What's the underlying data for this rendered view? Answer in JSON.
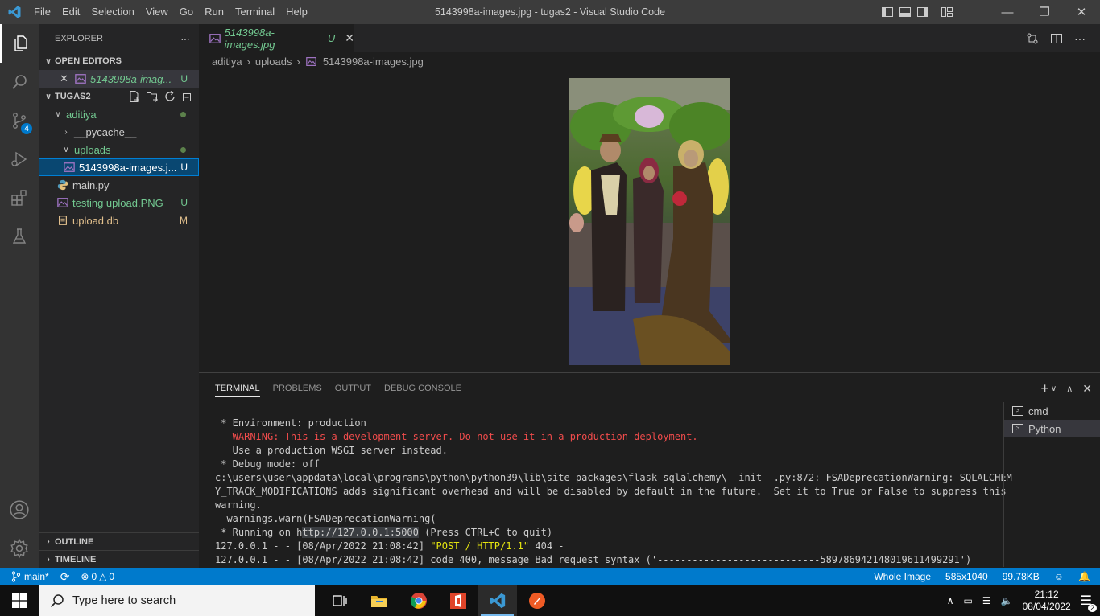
{
  "titlebar": {
    "menu": [
      "File",
      "Edit",
      "Selection",
      "View",
      "Go",
      "Run",
      "Terminal",
      "Help"
    ],
    "title": "5143998a-images.jpg - tugas2 - Visual Studio Code"
  },
  "activitybar": {
    "source_control_badge": "4"
  },
  "sidebar": {
    "title": "EXPLORER",
    "more": "···",
    "open_editors_label": "OPEN EDITORS",
    "open_editor": {
      "name": "5143998a-imag...",
      "status": "U"
    },
    "folder_label": "TUGAS2",
    "tree": {
      "aditiya": "aditiya",
      "pycache": "__pycache__",
      "uploads": "uploads",
      "image_file": "5143998a-images.j...",
      "image_status": "U",
      "main_py": "main.py",
      "testing": "testing upload.PNG",
      "testing_status": "U",
      "upload_db": "upload.db",
      "upload_db_status": "M"
    },
    "outline_label": "OUTLINE",
    "timeline_label": "TIMELINE"
  },
  "editor": {
    "tab_name": "5143998a-images.jpg",
    "tab_status": "U",
    "breadcrumb": [
      "aditiya",
      "uploads",
      "5143998a-images.jpg"
    ]
  },
  "panel": {
    "tabs": [
      "TERMINAL",
      "PROBLEMS",
      "OUTPUT",
      "DEBUG CONSOLE"
    ],
    "terminals": [
      "cmd",
      "Python"
    ],
    "lines": {
      "l1": " * Environment: production",
      "l2": "   WARNING: This is a development server. Do not use it in a production deployment.",
      "l3": "   Use a production WSGI server instead.",
      "l4": " * Debug mode: off",
      "l5": "c:\\users\\user\\appdata\\local\\programs\\python\\python39\\lib\\site-packages\\flask_sqlalchemy\\__init__.py:872: FSADeprecationWarning: SQLALCHEM",
      "l6": "Y_TRACK_MODIFICATIONS adds significant overhead and will be disabled by default in the future.  Set it to True or False to suppress this",
      "l7": "warning.",
      "l8": "  warnings.warn(FSADeprecationWarning(",
      "l9a": " * Running on h",
      "l9b": "ttp://127.0.0.1:5000",
      "l9c": " (Press CTRL+C to quit)",
      "l10a": "127.0.0.1 - - [08/Apr/2022 21:08:42] ",
      "l10b": "\"POST / HTTP/1.1\"",
      "l10c": " 404 -",
      "l11": "127.0.0.1 - - [08/Apr/2022 21:08:42] code 400, message Bad request syntax ('----------------------------589786942148019611499291')"
    }
  },
  "statusbar": {
    "branch": "main*",
    "errors": "0",
    "warnings": "0",
    "zoom": "Whole Image",
    "dimensions": "585x1040",
    "size": "99.78KB"
  },
  "taskbar": {
    "search_placeholder": "Type here to search",
    "time": "21:12",
    "date": "08/04/2022",
    "notifications": "2"
  },
  "colors": {
    "accent": "#007acc",
    "untracked": "#73c991",
    "modified": "#e2c08d"
  }
}
